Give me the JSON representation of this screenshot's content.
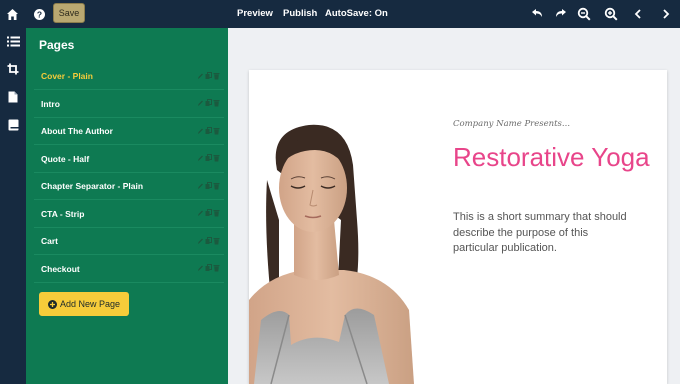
{
  "toolbar": {
    "save_label": "Save",
    "preview_label": "Preview",
    "publish_label": "Publish",
    "autosave_label": "AutoSave: On",
    "icons": [
      "home-icon",
      "help-icon",
      "undo-icon",
      "redo-icon",
      "zoom-out-icon",
      "zoom-in-icon",
      "chevron-left-icon",
      "chevron-right-icon"
    ]
  },
  "rail": {
    "icons": [
      "list-icon",
      "crop-icon",
      "document-icon",
      "book-icon"
    ]
  },
  "pages_panel": {
    "title": "Pages",
    "items": [
      {
        "label": "Cover - Plain",
        "active": true
      },
      {
        "label": "Intro",
        "active": false
      },
      {
        "label": "About The Author",
        "active": false
      },
      {
        "label": "Quote - Half",
        "active": false
      },
      {
        "label": "Chapter Separator - Plain",
        "active": false
      },
      {
        "label": "CTA - Strip",
        "active": false
      },
      {
        "label": "Cart",
        "active": false
      },
      {
        "label": "Checkout",
        "active": false
      }
    ],
    "add_button_label": "Add New Page"
  },
  "cover": {
    "presents": "Company Name Presents...",
    "title": "Restorative Yoga",
    "summary": "This is a short summary that should describe the purpose of this particular publication."
  },
  "colors": {
    "topbar": "#162a40",
    "panel": "#0e7a52",
    "accent": "#f6cc3a",
    "title_pink": "#e8458a"
  }
}
